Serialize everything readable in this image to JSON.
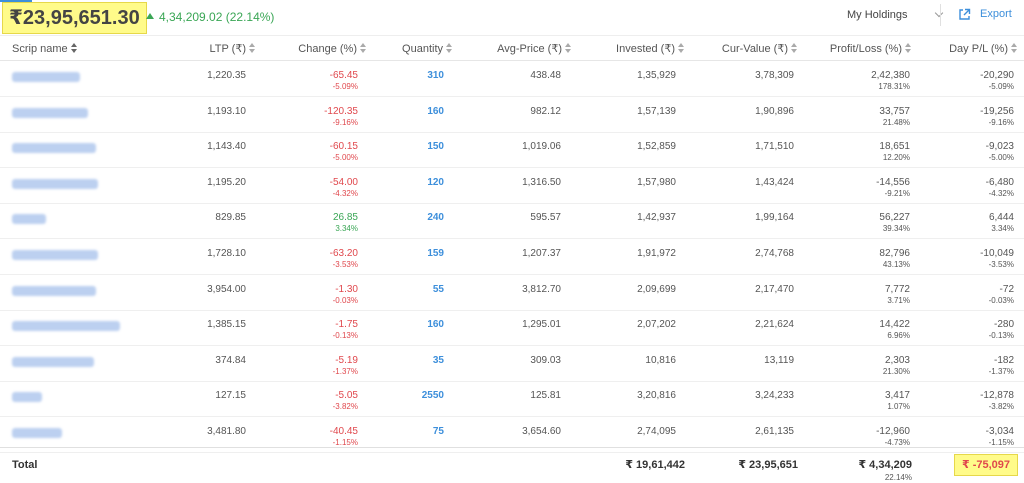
{
  "summary": {
    "total_value": "₹23,95,651.30",
    "gain_text": "4,34,209.02 (22.14%)"
  },
  "toolbar": {
    "holdings_select": "My Holdings",
    "export_label": "Export"
  },
  "columns": {
    "scrip": "Scrip name",
    "ltp": "LTP (₹)",
    "change": "Change (%)",
    "quantity": "Quantity",
    "avg_price": "Avg-Price (₹)",
    "invested": "Invested (₹)",
    "cur_value": "Cur-Value (₹)",
    "pl": "Profit/Loss (%)",
    "day_pl": "Day P/L (%)"
  },
  "rows": [
    {
      "ltp": "1,220.35",
      "change": "-65.45",
      "change_pct": "-5.09%",
      "qty": "310",
      "avg": "438.48",
      "invested": "1,35,929",
      "cur": "3,78,309",
      "pl": "2,42,380",
      "pl_pct": "178.31%",
      "day": "-20,290",
      "day_pct": "-5.09%"
    },
    {
      "ltp": "1,193.10",
      "change": "-120.35",
      "change_pct": "-9.16%",
      "qty": "160",
      "avg": "982.12",
      "invested": "1,57,139",
      "cur": "1,90,896",
      "pl": "33,757",
      "pl_pct": "21.48%",
      "day": "-19,256",
      "day_pct": "-9.16%"
    },
    {
      "ltp": "1,143.40",
      "change": "-60.15",
      "change_pct": "-5.00%",
      "qty": "150",
      "avg": "1,019.06",
      "invested": "1,52,859",
      "cur": "1,71,510",
      "pl": "18,651",
      "pl_pct": "12.20%",
      "day": "-9,023",
      "day_pct": "-5.00%"
    },
    {
      "ltp": "1,195.20",
      "change": "-54.00",
      "change_pct": "-4.32%",
      "qty": "120",
      "avg": "1,316.50",
      "invested": "1,57,980",
      "cur": "1,43,424",
      "pl": "-14,556",
      "pl_pct": "-9.21%",
      "day": "-6,480",
      "day_pct": "-4.32%"
    },
    {
      "ltp": "829.85",
      "change": "26.85",
      "change_pct": "3.34%",
      "qty": "240",
      "avg": "595.57",
      "invested": "1,42,937",
      "cur": "1,99,164",
      "pl": "56,227",
      "pl_pct": "39.34%",
      "day": "6,444",
      "day_pct": "3.34%"
    },
    {
      "ltp": "1,728.10",
      "change": "-63.20",
      "change_pct": "-3.53%",
      "qty": "159",
      "avg": "1,207.37",
      "invested": "1,91,972",
      "cur": "2,74,768",
      "pl": "82,796",
      "pl_pct": "43.13%",
      "day": "-10,049",
      "day_pct": "-3.53%"
    },
    {
      "ltp": "3,954.00",
      "change": "-1.30",
      "change_pct": "-0.03%",
      "qty": "55",
      "avg": "3,812.70",
      "invested": "2,09,699",
      "cur": "2,17,470",
      "pl": "7,772",
      "pl_pct": "3.71%",
      "day": "-72",
      "day_pct": "-0.03%"
    },
    {
      "ltp": "1,385.15",
      "change": "-1.75",
      "change_pct": "-0.13%",
      "qty": "160",
      "avg": "1,295.01",
      "invested": "2,07,202",
      "cur": "2,21,624",
      "pl": "14,422",
      "pl_pct": "6.96%",
      "day": "-280",
      "day_pct": "-0.13%"
    },
    {
      "ltp": "374.84",
      "change": "-5.19",
      "change_pct": "-1.37%",
      "qty": "35",
      "avg": "309.03",
      "invested": "10,816",
      "cur": "13,119",
      "pl": "2,303",
      "pl_pct": "21.30%",
      "day": "-182",
      "day_pct": "-1.37%"
    },
    {
      "ltp": "127.15",
      "change": "-5.05",
      "change_pct": "-3.82%",
      "qty": "2550",
      "avg": "125.81",
      "invested": "3,20,816",
      "cur": "3,24,233",
      "pl": "3,417",
      "pl_pct": "1.07%",
      "day": "-12,878",
      "day_pct": "-3.82%"
    },
    {
      "ltp": "3,481.80",
      "change": "-40.45",
      "change_pct": "-1.15%",
      "qty": "75",
      "avg": "3,654.60",
      "invested": "2,74,095",
      "cur": "2,61,135",
      "pl": "-12,960",
      "pl_pct": "-4.73%",
      "day": "-3,034",
      "day_pct": "-1.15%"
    }
  ],
  "totals": {
    "label": "Total",
    "invested": "₹ 19,61,442",
    "cur_value": "₹ 23,95,651",
    "pl": "₹ 4,34,209",
    "pl_pct": "22.14%",
    "day_pl": "₹ -75,097"
  },
  "colors": {
    "negative": "#e0484d",
    "positive": "#3aa655",
    "accent": "#3d8fdb",
    "highlight": "#fffb8a"
  }
}
